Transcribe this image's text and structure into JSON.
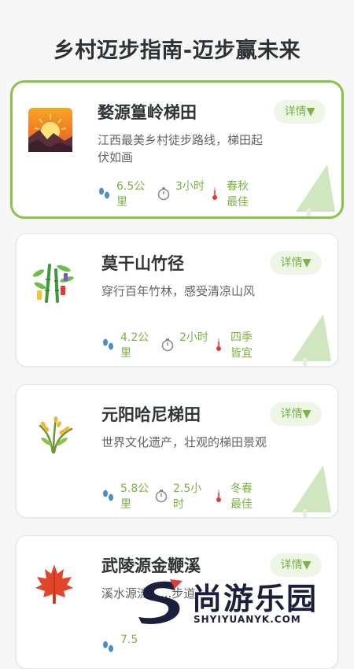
{
  "page": {
    "title": "乡村迈步指南-迈步赢未来"
  },
  "detail_label": "详情▼",
  "cards": [
    {
      "name": "婺源篁岭梯田",
      "desc": "江西最美乡村徒步路线，梯田起伏如画",
      "distance": "6.5公里",
      "duration": "3小时",
      "season": "春秋最佳",
      "icon": "sunrise-mountain-icon"
    },
    {
      "name": "莫干山竹径",
      "desc": "穿行百年竹林，感受清凉山风",
      "distance": "4.2公里",
      "duration": "2小时",
      "season": "四季皆宜",
      "icon": "bamboo-icon"
    },
    {
      "name": "元阳哈尼梯田",
      "desc": "世界文化遗产，壮观的梯田景观",
      "distance": "5.8公里",
      "duration": "2.5小时",
      "season": "冬春最佳",
      "icon": "rice-icon"
    },
    {
      "name": "武陵源金鞭溪",
      "desc": "溪水源流，...步道",
      "distance": "7.5",
      "duration": "",
      "season": "",
      "icon": "maple-leaf-icon"
    }
  ],
  "watermark": {
    "text": "尚游乐园",
    "sub": "SHYIYUANYK.COM"
  },
  "colors": {
    "accent": "#8bc34a",
    "accent_text": "#7cb342",
    "title": "#2b3134"
  }
}
